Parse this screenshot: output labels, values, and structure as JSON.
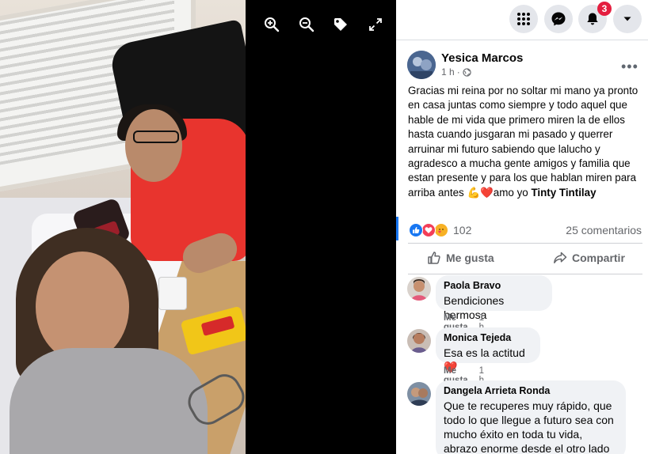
{
  "viewer": {
    "tools": [
      {
        "icon": "zoom-in-icon"
      },
      {
        "icon": "zoom-out-icon"
      },
      {
        "icon": "tag-icon"
      },
      {
        "icon": "fullscreen-icon"
      }
    ]
  },
  "topbar": {
    "notifications_badge": "3",
    "icons": [
      "menu-grid-icon",
      "messenger-icon",
      "bell-icon",
      "caret-down-icon"
    ]
  },
  "post": {
    "author": "Yesica Marcos",
    "time": "1 h",
    "separator": "·",
    "audience_icon": "globe-icon",
    "text": "Gracias mi reina por no soltar mi mano ya pronto en casa juntas como siempre y todo aquel que hable de mi vida que primero miren la de ellos hasta cuando jusgaran mi pasado y querrer arruinar mi futuro sabiendo que lalucho y agradesco a mucha gente amigos y familia que estan presente y para los que hablan miren para arriba antes ",
    "emoji": "💪❤️",
    "text_tail": "amo yo ",
    "tagged": "Tinty Tintilay",
    "reaction_count": "102",
    "comment_count": "25 comentarios",
    "like_label": "Me gusta",
    "share_label": "Compartir",
    "reaction_icons": [
      "like-reaction-icon",
      "love-reaction-icon",
      "care-reaction-icon"
    ]
  },
  "comments": [
    {
      "name": "Paola Bravo",
      "text": "Bendiciones hermosa",
      "like_label": "Me gusta",
      "time": "1 h"
    },
    {
      "name": "Monica Tejeda",
      "text": "Esa es la actitud",
      "emoji": "❤️",
      "like_label": "Me gusta",
      "time": "1 h"
    },
    {
      "name": "Dangela Arrieta Ronda",
      "text": "Que te recuperes muy rápido, que todo lo que llegue a futuro sea con mucho éxito en toda tu vida, abrazo enorme desde el otro lado de la"
    }
  ],
  "colors": {
    "accent": "#1877f2",
    "badge": "#e41e3f",
    "secondary_text": "#65676b",
    "bubble": "#f0f2f5"
  }
}
